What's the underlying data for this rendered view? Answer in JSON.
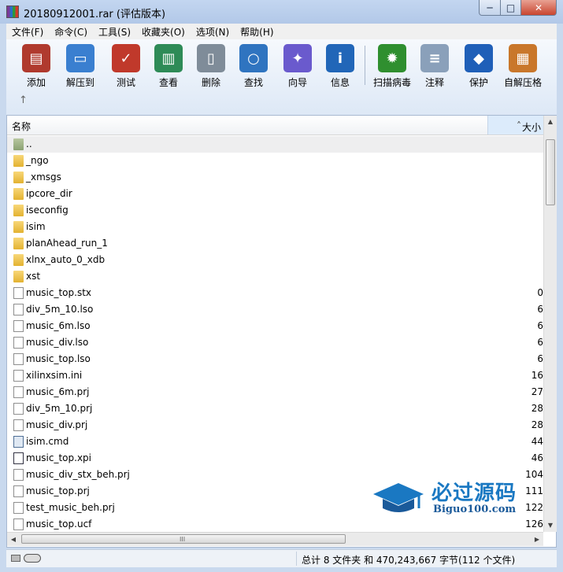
{
  "window": {
    "title": "20180912001.rar (评估版本)",
    "buttons": {
      "minimize": "─",
      "maximize": "□",
      "close": "✕"
    }
  },
  "menu": [
    "文件(F)",
    "命令(C)",
    "工具(S)",
    "收藏夹(O)",
    "选项(N)",
    "帮助(H)"
  ],
  "toolbar": [
    {
      "label": "添加",
      "icon": "add-archive-icon",
      "color": "#b03a2e"
    },
    {
      "label": "解压到",
      "icon": "extract-folder-icon",
      "color": "#3a7fd0"
    },
    {
      "label": "测试",
      "icon": "test-clipboard-icon",
      "color": "#c0392b"
    },
    {
      "label": "查看",
      "icon": "view-book-icon",
      "color": "#2e8b57"
    },
    {
      "label": "删除",
      "icon": "delete-trash-icon",
      "color": "#7f8c99"
    },
    {
      "label": "查找",
      "icon": "find-magnifier-icon",
      "color": "#2f74c0"
    },
    {
      "label": "向导",
      "icon": "wizard-wand-icon",
      "color": "#6a5acd"
    },
    {
      "label": "信息",
      "icon": "info-icon",
      "color": "#2166b8"
    },
    {
      "label": "扫描病毒",
      "icon": "virus-scan-icon",
      "color": "#2f8f2f"
    },
    {
      "label": "注释",
      "icon": "comment-icon",
      "color": "#8aa0ba"
    },
    {
      "label": "保护",
      "icon": "protect-shield-icon",
      "color": "#1f5fb8"
    },
    {
      "label": "自解压格",
      "icon": "sfx-archive-icon",
      "color": "#c9772b"
    }
  ],
  "toolbar_up_arrow": "↑",
  "columns": {
    "name": "名称",
    "size": "大小",
    "sort_indicator": "˄"
  },
  "files": [
    {
      "name": "..",
      "type": "up",
      "size": ""
    },
    {
      "name": "_ngo",
      "type": "folder",
      "size": ""
    },
    {
      "name": "_xmsgs",
      "type": "folder",
      "size": ""
    },
    {
      "name": "ipcore_dir",
      "type": "folder",
      "size": ""
    },
    {
      "name": "iseconfig",
      "type": "folder",
      "size": ""
    },
    {
      "name": "isim",
      "type": "folder",
      "size": ""
    },
    {
      "name": "planAhead_run_1",
      "type": "folder",
      "size": ""
    },
    {
      "name": "xlnx_auto_0_xdb",
      "type": "folder",
      "size": ""
    },
    {
      "name": "xst",
      "type": "folder",
      "size": ""
    },
    {
      "name": "music_top.stx",
      "type": "file",
      "size": "0"
    },
    {
      "name": "div_5m_10.lso",
      "type": "file",
      "size": "6"
    },
    {
      "name": "music_6m.lso",
      "type": "file",
      "size": "6"
    },
    {
      "name": "music_div.lso",
      "type": "file",
      "size": "6"
    },
    {
      "name": "music_top.lso",
      "type": "file",
      "size": "6"
    },
    {
      "name": "xilinxsim.ini",
      "type": "ini",
      "size": "16"
    },
    {
      "name": "music_6m.prj",
      "type": "file",
      "size": "27"
    },
    {
      "name": "div_5m_10.prj",
      "type": "file",
      "size": "28"
    },
    {
      "name": "music_div.prj",
      "type": "file",
      "size": "28"
    },
    {
      "name": "isim.cmd",
      "type": "cmd",
      "size": "44"
    },
    {
      "name": "music_top.xpi",
      "type": "xpi",
      "size": "46"
    },
    {
      "name": "music_div_stx_beh.prj",
      "type": "file",
      "size": "104"
    },
    {
      "name": "music_top.prj",
      "type": "file",
      "size": "111"
    },
    {
      "name": "test_music_beh.prj",
      "type": "file",
      "size": "122"
    },
    {
      "name": "music_top.ucf",
      "type": "file",
      "size": "126"
    }
  ],
  "scroll": {
    "up": "▲",
    "down": "▼",
    "left": "◀",
    "right": "▶",
    "grip": "III"
  },
  "status": {
    "summary": "总计 8 文件夹 和 470,243,667 字节(112 个文件)"
  },
  "watermark": {
    "title": "必过源码",
    "subtitle": "Biguo100.com"
  }
}
